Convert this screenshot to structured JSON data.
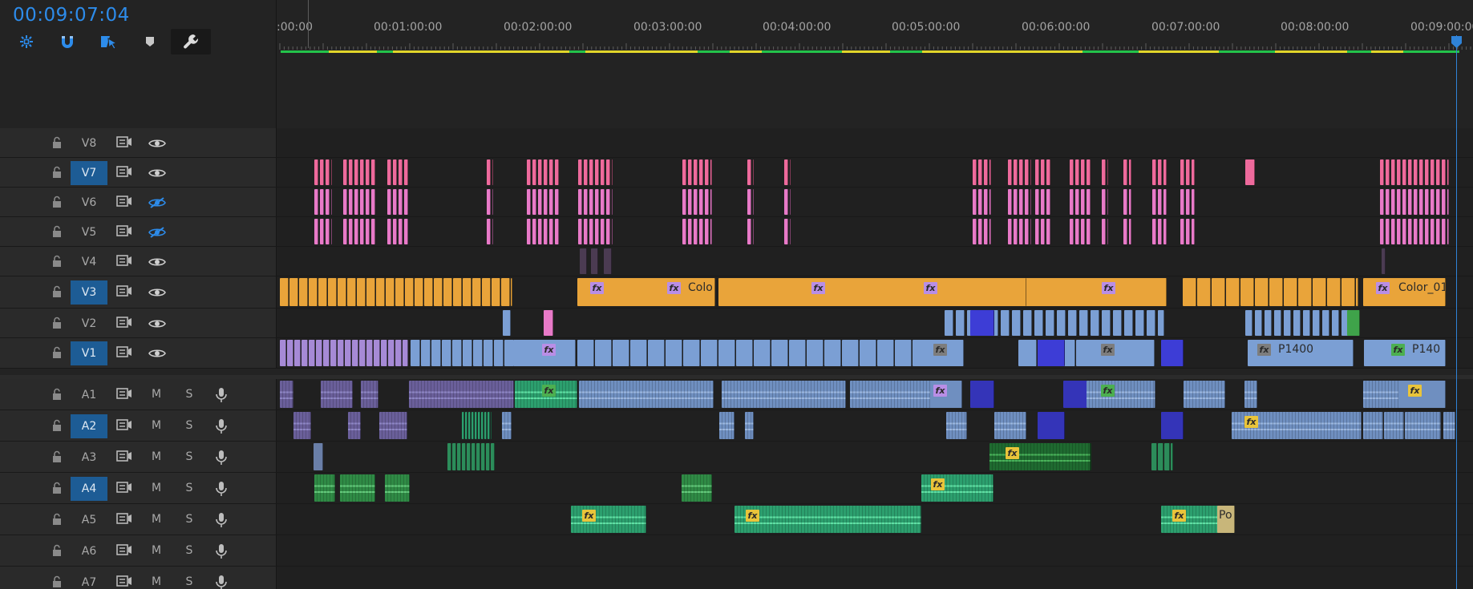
{
  "timecode": "00:09:07:04",
  "toolbar": {
    "tools": [
      {
        "name": "nest-sequence",
        "label": "Insert or overwrite sequences as nests or individual clips",
        "icon": "nest-icon",
        "active": false
      },
      {
        "name": "snap",
        "label": "Snap in Timeline",
        "icon": "magnet-icon",
        "active": false
      },
      {
        "name": "linked-selection",
        "label": "Linked Selection",
        "icon": "linked-selection-icon",
        "active": false
      },
      {
        "name": "add-marker",
        "label": "Add Marker",
        "icon": "marker-icon",
        "active": false
      },
      {
        "name": "timeline-settings",
        "label": "Timeline Display Settings",
        "icon": "wrench-icon",
        "active": true
      }
    ]
  },
  "ruler": {
    "labels": [
      ":00:00",
      "00:01:00:00",
      "00:02:00:00",
      "00:03:00:00",
      "00:04:00:00",
      "00:05:00:00",
      "00:06:00:00",
      "00:07:00:00",
      "00:08:00:00",
      "00:09:00:00"
    ]
  },
  "video_tracks": [
    {
      "label": "V8",
      "selected": false,
      "visible": true
    },
    {
      "label": "V7",
      "selected": true,
      "visible": true
    },
    {
      "label": "V6",
      "selected": false,
      "visible": false
    },
    {
      "label": "V5",
      "selected": false,
      "visible": false
    },
    {
      "label": "V4",
      "selected": false,
      "visible": true
    },
    {
      "label": "V3",
      "selected": true,
      "visible": true
    },
    {
      "label": "V2",
      "selected": false,
      "visible": true
    },
    {
      "label": "V1",
      "selected": true,
      "visible": true
    }
  ],
  "audio_tracks": [
    {
      "label": "A1",
      "selected": false,
      "m": "M",
      "s": "S"
    },
    {
      "label": "A2",
      "selected": true,
      "m": "M",
      "s": "S"
    },
    {
      "label": "A3",
      "selected": false,
      "m": "M",
      "s": "S"
    },
    {
      "label": "A4",
      "selected": true,
      "m": "M",
      "s": "S"
    },
    {
      "label": "A5",
      "selected": false,
      "m": "M",
      "s": "S"
    },
    {
      "label": "A6",
      "selected": false,
      "m": "M",
      "s": "S"
    },
    {
      "label": "A7",
      "selected": false,
      "m": "M",
      "s": "S"
    }
  ],
  "clip_labels": {
    "v3_colo": "Colo",
    "v3_color01": "Color_01",
    "v1_p1400": "P1400",
    "v1_p140": "P140",
    "a5_po": "Po"
  },
  "fx_badge": "fx",
  "colors": {
    "accent": "#2d8ceb",
    "selected_track": "#1d5c95",
    "adjustment_pink": "#e87ac8",
    "adjustment_rose": "#ee6a9c",
    "orange_color_clip": "#e9a43a",
    "video_blue": "#7b9fd4",
    "video_purple": "#a68ad6",
    "audio_green": "#2c9f6e",
    "audio_blue": "#6f8fc0",
    "render_green": "#23c34a",
    "render_yellow": "#e1d52a"
  }
}
